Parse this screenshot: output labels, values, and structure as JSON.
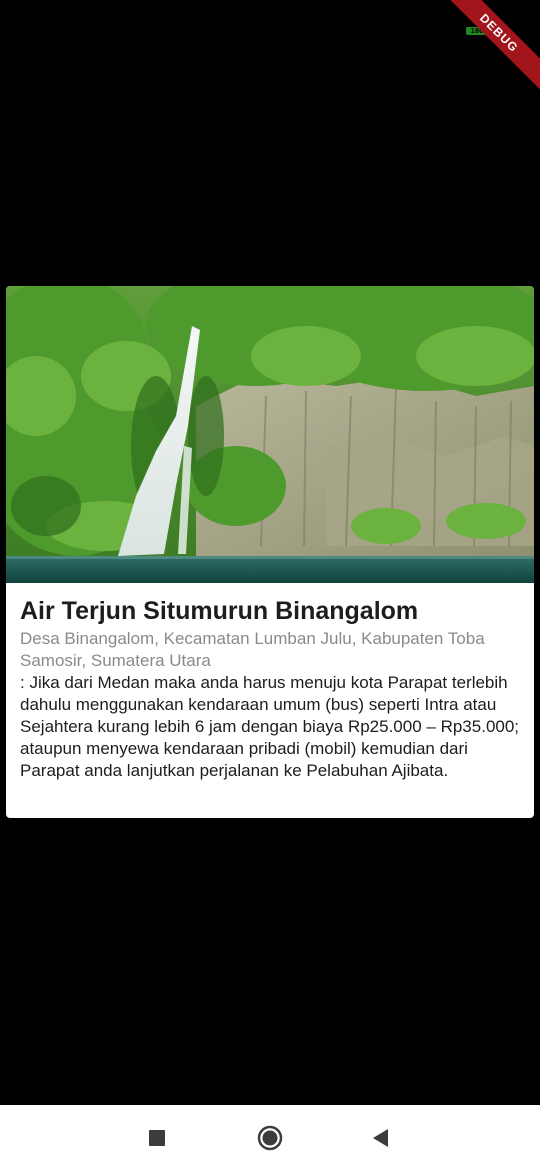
{
  "status_bar": {
    "battery_level": "100"
  },
  "debug_banner": {
    "label": "DEBUG"
  },
  "place": {
    "title": "Air Terjun Situmurun Binangalom",
    "location": "Desa Binangalom, Kecamatan Lumban Julu, Kabupaten Toba Samosir, Sumatera Utara",
    "description": ": Jika dari Medan maka anda harus menuju kota Parapat terlebih dahulu menggunakan kendaraan umum (bus) seperti Intra atau Sejahtera kurang lebih 6 jam dengan biaya Rp25.000 – Rp35.000; ataupun menyewa kendaraan pribadi (mobil) kemudian dari Parapat anda lanjutkan perjalanan ke Pelabuhan Ajibata."
  },
  "nav_bar": {
    "icons": [
      "recent-apps-icon",
      "home-icon",
      "back-icon"
    ]
  },
  "colors": {
    "background": "#000000",
    "card": "#ffffff",
    "title": "#1d1d1d",
    "subtitle": "#8a8a8a",
    "debug_banner": "#a2151b",
    "battery": "#1f8a1f"
  }
}
